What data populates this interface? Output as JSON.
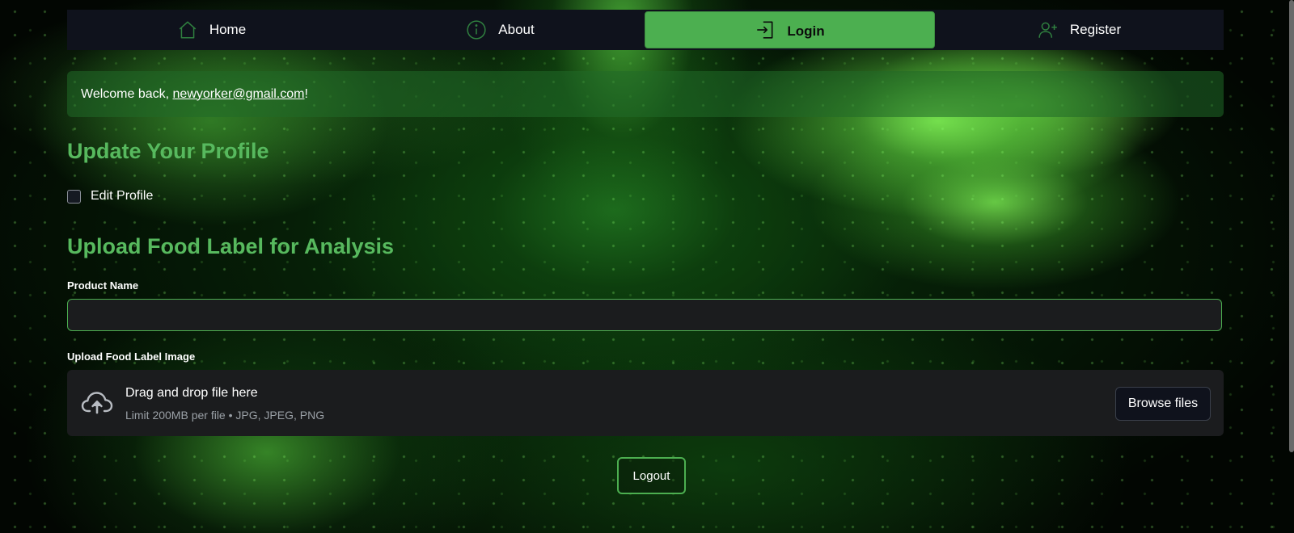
{
  "nav": {
    "items": [
      {
        "label": "Home",
        "icon": "home-icon"
      },
      {
        "label": "About",
        "icon": "info-icon"
      },
      {
        "label": "Login",
        "icon": "login-icon",
        "active": true
      },
      {
        "label": "Register",
        "icon": "add-user-icon"
      }
    ]
  },
  "welcome": {
    "prefix": "Welcome back, ",
    "email": "newyorker@gmail.com",
    "suffix": "!"
  },
  "profile": {
    "heading": "Update Your Profile",
    "checkbox_label": "Edit Profile",
    "checked": false
  },
  "upload": {
    "heading": "Upload Food Label for Analysis",
    "product_name_label": "Product Name",
    "product_name_value": "",
    "image_label": "Upload Food Label Image",
    "dropzone_title": "Drag and drop file here",
    "dropzone_limit": "Limit 200MB per file • JPG, JPEG, PNG",
    "browse_label": "Browse files"
  },
  "logout_label": "Logout",
  "colors": {
    "accent": "#4caf50",
    "heading": "#57b95e",
    "nav_bg": "#0f121c",
    "input_bg": "#1b1c1e"
  }
}
